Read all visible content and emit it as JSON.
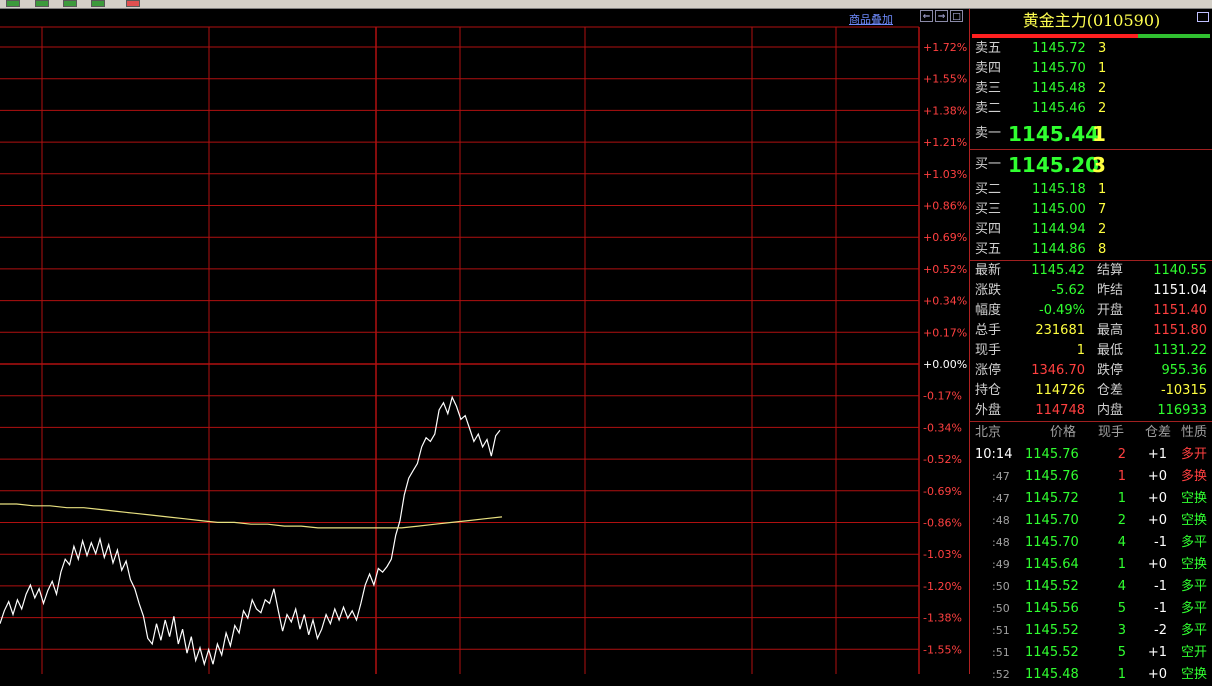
{
  "toolbar": {
    "buttons": [
      "",
      "",
      "",
      ""
    ]
  },
  "chart": {
    "overlay_label": "商品叠加",
    "window_buttons": [
      "⇐",
      "⇒",
      "□"
    ],
    "colors": {
      "grid": "#b01010",
      "price_line": "#ffffff",
      "avg_line": "#e8e080",
      "axis_pos": "#ff4040",
      "axis_zero": "#ffffff",
      "axis_neg": "#ff4040"
    }
  },
  "chart_data": {
    "type": "line",
    "y_axis_labels": [
      "+1.72%",
      "+1.55%",
      "+1.38%",
      "+1.21%",
      "+1.03%",
      "+0.86%",
      "+0.69%",
      "+0.52%",
      "+0.34%",
      "+0.17%",
      "+0.00%",
      "-0.17%",
      "-0.34%",
      "-0.52%",
      "-0.69%",
      "-0.86%",
      "-1.03%",
      "-1.20%",
      "-1.38%",
      "-1.55%"
    ],
    "ylim": [
      -1.72,
      1.72
    ],
    "series": [
      {
        "values": [
          -1.41,
          -1.34,
          -1.29,
          -1.36,
          -1.28,
          -1.33,
          -1.25,
          -1.2,
          -1.27,
          -1.22,
          -1.3,
          -1.23,
          -1.18,
          -1.25,
          -1.13,
          -1.06,
          -1.09,
          -0.99,
          -1.06,
          -0.96,
          -1.04,
          -0.97,
          -1.03,
          -0.95,
          -1.05,
          -0.98,
          -1.08,
          -1.01,
          -1.12,
          -1.07,
          -1.17,
          -1.22,
          -1.3,
          -1.37,
          -1.49,
          -1.52,
          -1.41,
          -1.5,
          -1.39,
          -1.48,
          -1.37,
          -1.52,
          -1.44,
          -1.57,
          -1.48,
          -1.61,
          -1.54,
          -1.63,
          -1.55,
          -1.63,
          -1.52,
          -1.58,
          -1.46,
          -1.53,
          -1.42,
          -1.46,
          -1.34,
          -1.38,
          -1.28,
          -1.33,
          -1.35,
          -1.28,
          -1.3,
          -1.22,
          -1.34,
          -1.45,
          -1.36,
          -1.4,
          -1.33,
          -1.44,
          -1.36,
          -1.47,
          -1.39,
          -1.49,
          -1.44,
          -1.36,
          -1.41,
          -1.33,
          -1.39,
          -1.32,
          -1.38,
          -1.34,
          -1.39,
          -1.3,
          -1.2,
          -1.14,
          -1.2,
          -1.11,
          -1.13,
          -1.1,
          -1.06,
          -0.93,
          -0.85,
          -0.71,
          -0.62,
          -0.58,
          -0.54,
          -0.45,
          -0.4,
          -0.42,
          -0.38,
          -0.25,
          -0.21,
          -0.27,
          -0.18,
          -0.23,
          -0.3,
          -0.28,
          -0.35,
          -0.42,
          -0.38,
          -0.45,
          -0.41,
          -0.5,
          -0.39,
          -0.36
        ]
      },
      {
        "values": [
          -0.76,
          -0.76,
          -0.77,
          -0.77,
          -0.78,
          -0.78,
          -0.79,
          -0.8,
          -0.81,
          -0.82,
          -0.83,
          -0.84,
          -0.85,
          -0.86,
          -0.86,
          -0.87,
          -0.87,
          -0.88,
          -0.88,
          -0.89,
          -0.89,
          -0.89,
          -0.89,
          -0.89,
          -0.89,
          -0.88,
          -0.87,
          -0.86,
          -0.85,
          -0.84,
          -0.83
        ]
      }
    ]
  },
  "panel": {
    "title": "黄金主力(010590)",
    "asks": [
      {
        "label": "卖五",
        "price": "1145.72",
        "vol": "3"
      },
      {
        "label": "卖四",
        "price": "1145.70",
        "vol": "1"
      },
      {
        "label": "卖三",
        "price": "1145.48",
        "vol": "2"
      },
      {
        "label": "卖二",
        "price": "1145.46",
        "vol": "2"
      }
    ],
    "ask1": {
      "label": "卖一",
      "price": "1145.44",
      "vol": "1"
    },
    "bid1": {
      "label": "买一",
      "price": "1145.20",
      "vol": "3"
    },
    "bids": [
      {
        "label": "买二",
        "price": "1145.18",
        "vol": "1"
      },
      {
        "label": "买三",
        "price": "1145.00",
        "vol": "7"
      },
      {
        "label": "买四",
        "price": "1144.94",
        "vol": "2"
      },
      {
        "label": "买五",
        "price": "1144.86",
        "vol": "8"
      }
    ],
    "stats": [
      {
        "l1": "最新",
        "v1": "1145.42",
        "c1": "green",
        "l2": "结算",
        "v2": "1140.55",
        "c2": "green"
      },
      {
        "l1": "涨跌",
        "v1": "-5.62",
        "c1": "green",
        "l2": "昨结",
        "v2": "1151.04",
        "c2": "white"
      },
      {
        "l1": "幅度",
        "v1": "-0.49%",
        "c1": "green",
        "l2": "开盘",
        "v2": "1151.40",
        "c2": "red"
      },
      {
        "l1": "总手",
        "v1": "231681",
        "c1": "yellow",
        "l2": "最高",
        "v2": "1151.80",
        "c2": "red"
      },
      {
        "l1": "现手",
        "v1": "1",
        "c1": "yellow",
        "l2": "最低",
        "v2": "1131.22",
        "c2": "green"
      },
      {
        "l1": "涨停",
        "v1": "1346.70",
        "c1": "red",
        "l2": "跌停",
        "v2": "955.36",
        "c2": "green"
      },
      {
        "l1": "持仓",
        "v1": "114726",
        "c1": "yellow",
        "l2": "仓差",
        "v2": "-10315",
        "c2": "yellow"
      },
      {
        "l1": "外盘",
        "v1": "114748",
        "c1": "red",
        "l2": "内盘",
        "v2": "116933",
        "c2": "green"
      }
    ],
    "ticks_header": {
      "time": "北京",
      "price": "价格",
      "vol": "现手",
      "oi": "仓差",
      "nature": "性质"
    },
    "ticks": [
      {
        "time": "10:14",
        "price": "1145.76",
        "vol": "2",
        "vc": "red",
        "oi": "+1",
        "nature": "多开",
        "nc": "red"
      },
      {
        "time": ":47",
        "price": "1145.76",
        "vol": "1",
        "vc": "red",
        "oi": "+0",
        "nature": "多换",
        "nc": "red"
      },
      {
        "time": ":47",
        "price": "1145.72",
        "vol": "1",
        "vc": "green",
        "oi": "+0",
        "nature": "空换",
        "nc": "green"
      },
      {
        "time": ":48",
        "price": "1145.70",
        "vol": "2",
        "vc": "green",
        "oi": "+0",
        "nature": "空换",
        "nc": "green"
      },
      {
        "time": ":48",
        "price": "1145.70",
        "vol": "4",
        "vc": "green",
        "oi": "-1",
        "nature": "多平",
        "nc": "green"
      },
      {
        "time": ":49",
        "price": "1145.64",
        "vol": "1",
        "vc": "green",
        "oi": "+0",
        "nature": "空换",
        "nc": "green"
      },
      {
        "time": ":50",
        "price": "1145.52",
        "vol": "4",
        "vc": "green",
        "oi": "-1",
        "nature": "多平",
        "nc": "green"
      },
      {
        "time": ":50",
        "price": "1145.56",
        "vol": "5",
        "vc": "green",
        "oi": "-1",
        "nature": "多平",
        "nc": "green"
      },
      {
        "time": ":51",
        "price": "1145.52",
        "vol": "3",
        "vc": "green",
        "oi": "-2",
        "nature": "多平",
        "nc": "green"
      },
      {
        "time": ":51",
        "price": "1145.52",
        "vol": "5",
        "vc": "green",
        "oi": "+1",
        "nature": "空开",
        "nc": "green"
      },
      {
        "time": ":52",
        "price": "1145.48",
        "vol": "1",
        "vc": "green",
        "oi": "+0",
        "nature": "空换",
        "nc": "green"
      }
    ]
  }
}
